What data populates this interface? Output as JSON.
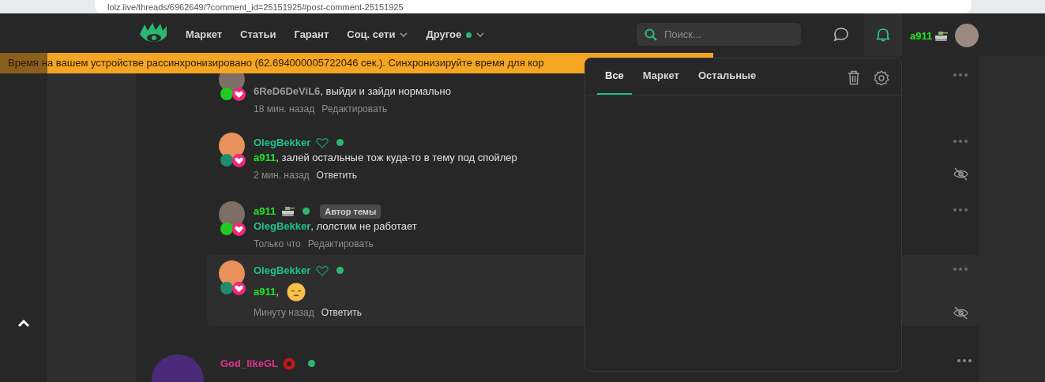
{
  "browser": {
    "url": "lolz.live/threads/6962649/?comment_id=25151925#post-comment-25151925"
  },
  "nav": {
    "items": [
      {
        "label": "Маркет",
        "dropdown": false,
        "dot": false
      },
      {
        "label": "Статьи",
        "dropdown": false,
        "dot": false
      },
      {
        "label": "Гарант",
        "dropdown": false,
        "dot": false
      },
      {
        "label": "Соц. сети",
        "dropdown": true,
        "dot": false
      },
      {
        "label": "Другое",
        "dropdown": true,
        "dot": true
      }
    ],
    "search": {
      "placeholder": "Поиск..."
    },
    "user": {
      "name": "a911",
      "color": "#22e622"
    }
  },
  "banner": {
    "text": "Время на вашем устройстве рассинхронизировано (62.694000005722046 сек.). Синхронизируйте время для кор"
  },
  "comments": [
    {
      "kind": "photo",
      "mention": {
        "name": "6ReD6DeViL6",
        "color": "#9a9a9a"
      },
      "text": ", выйди и зайди нормально",
      "emoji": false,
      "time": "18 мин. назад",
      "action": {
        "kind": "edit",
        "label": "Редактировать"
      },
      "selected": false,
      "hide_button": false
    },
    {
      "kind": "cartoon",
      "author": {
        "name": "OlegBekker",
        "color": "#1fc28a"
      },
      "mention": {
        "name": "a911",
        "color": "#22e622"
      },
      "text": ", залей остальные тож куда-то в тему под спойлер",
      "emoji": false,
      "time": "2 мин. назад",
      "action": {
        "kind": "reply",
        "label": "Ответить"
      },
      "selected": false,
      "hide_button": true
    },
    {
      "kind": "photo",
      "author": {
        "name": "a911",
        "color": "#22e622"
      },
      "tag": "Автор темы",
      "mention": {
        "name": "OlegBekker",
        "color": "#1fc28a"
      },
      "text": ", лолстим не работает",
      "emoji": false,
      "time": "Только что",
      "action": {
        "kind": "edit",
        "label": "Редактировать"
      },
      "selected": false,
      "hide_button": false
    },
    {
      "kind": "cartoon",
      "author": {
        "name": "OlegBekker",
        "color": "#1fc28a"
      },
      "mention": {
        "name": "a911",
        "color": "#22e622"
      },
      "text": ",",
      "emoji": true,
      "time": "Минуту назад",
      "action": {
        "kind": "reply",
        "label": "Ответить"
      },
      "selected": true,
      "hide_button": true
    }
  ],
  "next_post": {
    "author": {
      "name": "God_likeGL",
      "color": "#e0338f"
    }
  },
  "notifications": {
    "tabs": [
      {
        "label": "Все",
        "selected": true
      },
      {
        "label": "Маркет",
        "selected": false
      },
      {
        "label": "Остальные",
        "selected": false
      }
    ]
  }
}
